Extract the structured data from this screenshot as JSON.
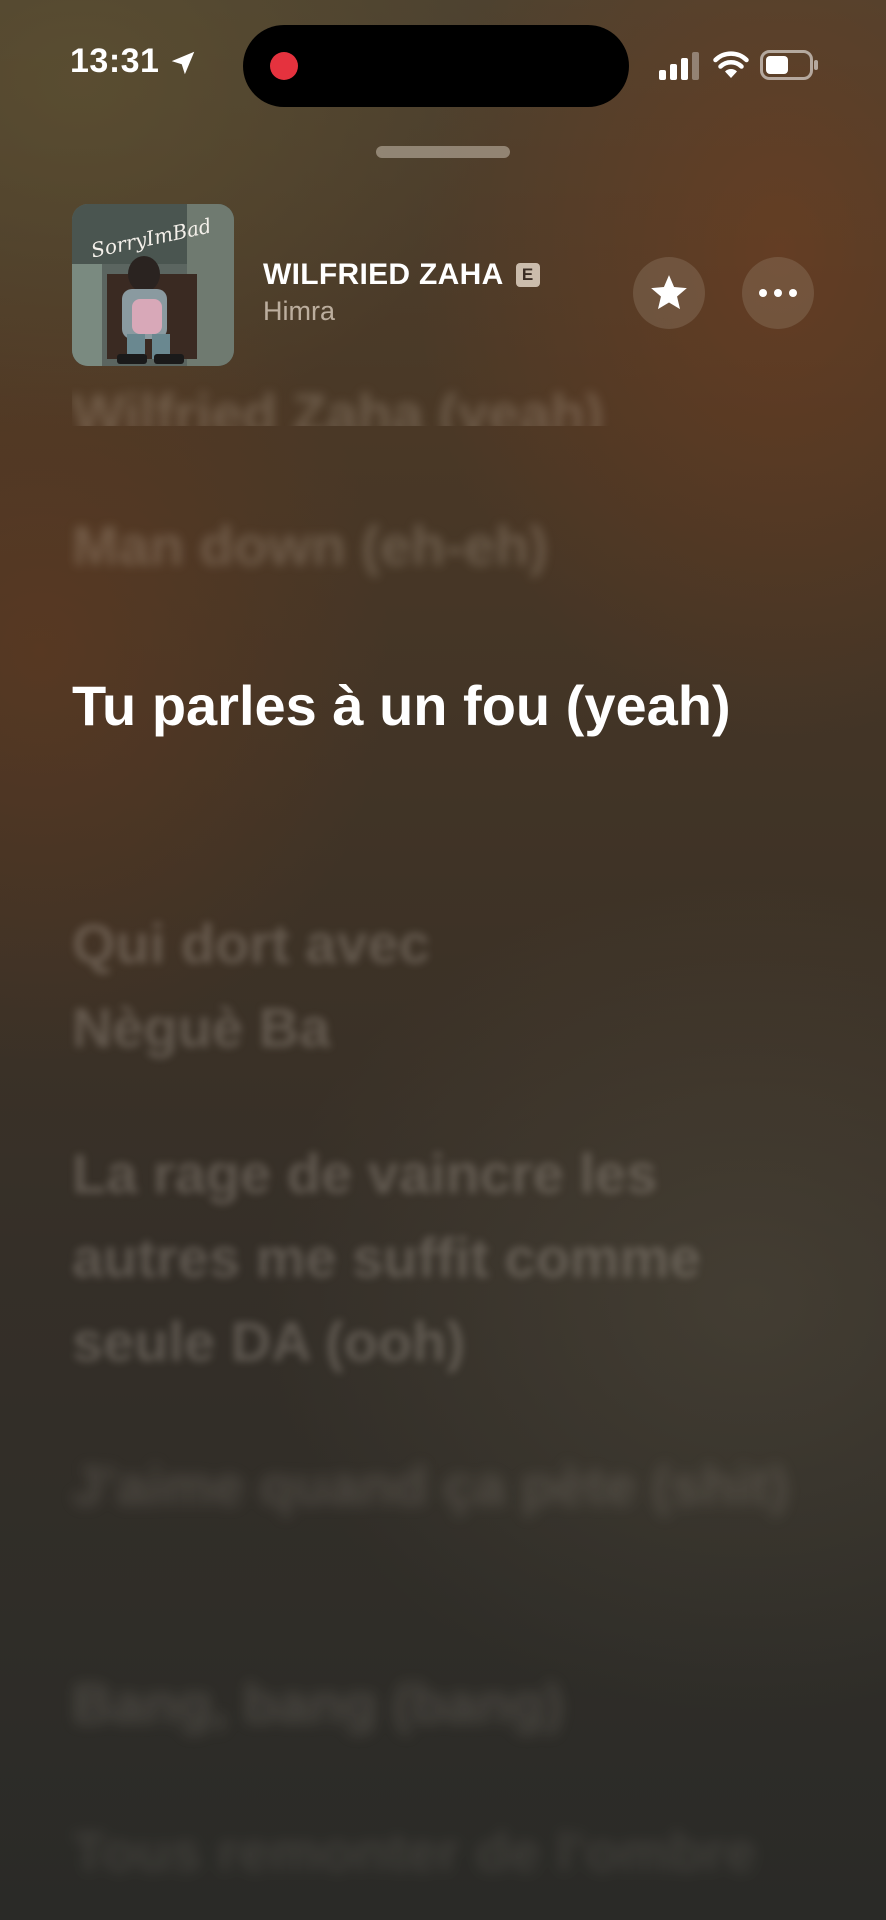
{
  "status_bar": {
    "time": "13:31",
    "icons": [
      "location-arrow-icon",
      "cellular-signal-icon",
      "wifi-icon",
      "battery-icon"
    ],
    "recording_indicator_color": "#e5323e"
  },
  "now_playing": {
    "title": "WILFRIED ZAHA",
    "explicit_badge": "E",
    "artist": "Himra",
    "artwork_text": "SorryImBad"
  },
  "lyrics": [
    {
      "text": "Wilfried Zaha (yeah)",
      "state": "past"
    },
    {
      "text": "Man down (eh-eh)",
      "state": "past"
    },
    {
      "text": "Tu parles à un fou (yeah)",
      "state": "active"
    },
    {
      "text": "Qui dort avec Nèguè Ba",
      "state": "upcoming"
    },
    {
      "text": "La rage de vaincre les autres me suffit comme seule DA (ooh)",
      "state": "upcoming"
    },
    {
      "text": "J'aime quand ça pète (shit)",
      "state": "far"
    },
    {
      "text": "Bang, bang (bang)",
      "state": "far"
    },
    {
      "text": "Tous remonter de l'ombre",
      "state": "far"
    }
  ],
  "colors": {
    "active_lyric": "#ffffff",
    "accent_record": "#e5323e"
  }
}
